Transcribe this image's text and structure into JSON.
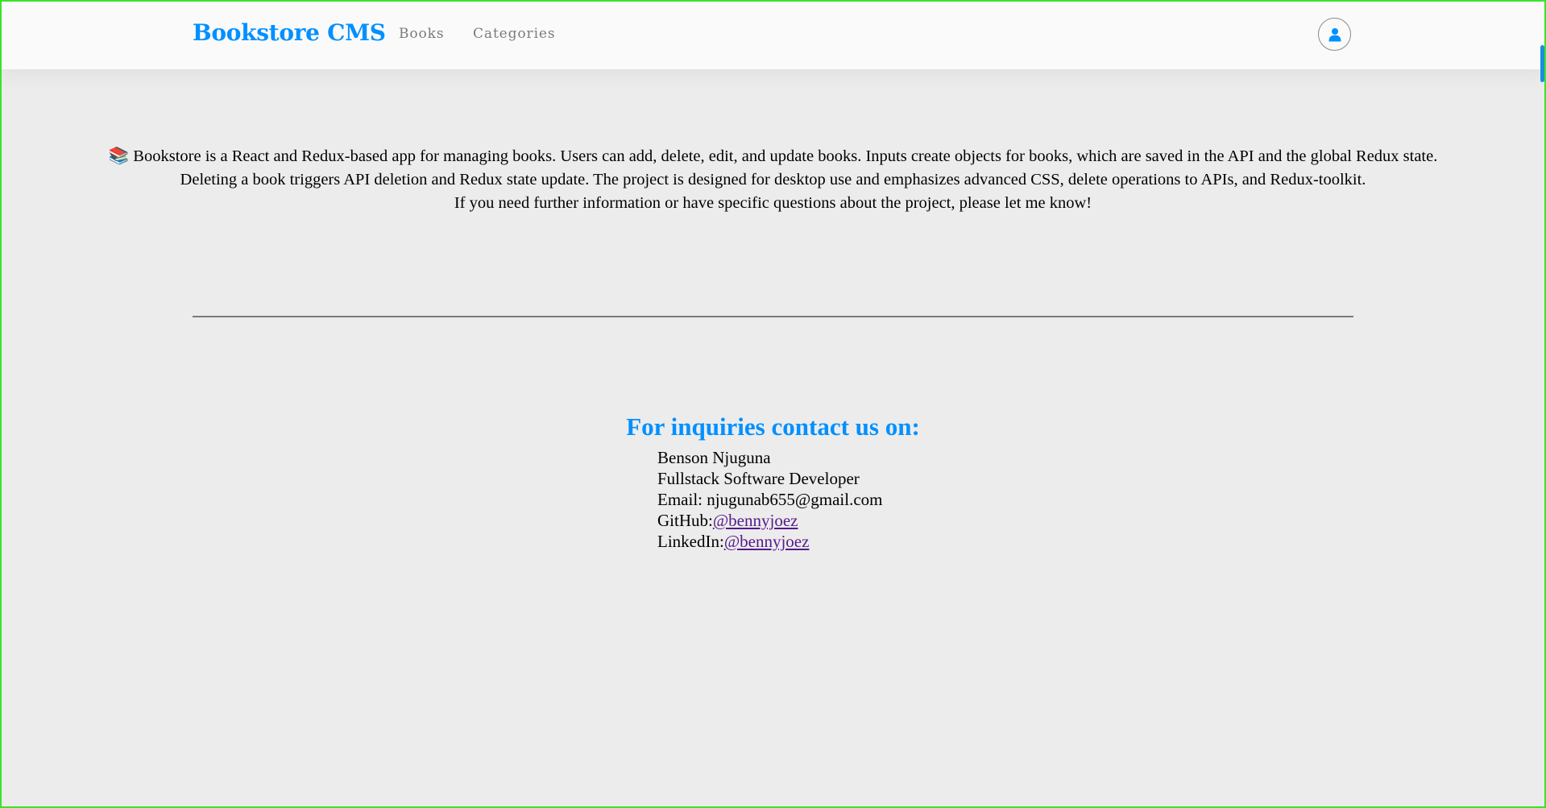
{
  "navbar": {
    "brand": "Bookstore CMS",
    "links": [
      {
        "label": "Books"
      },
      {
        "label": "Categories"
      }
    ],
    "profile_icon": "user-icon"
  },
  "about": {
    "emoji": "📚",
    "lines": [
      "Bookstore is a React and Redux-based app for managing books. Users can add, delete, edit, and update books. Inputs create objects for books, which are saved in the API and the global Redux state.",
      "Deleting a book triggers API deletion and Redux state update. The project is designed for desktop use and emphasizes advanced CSS, delete operations to APIs, and Redux-toolkit.",
      "If you need further information or have specific questions about the project, please let me know!"
    ]
  },
  "contact": {
    "heading": "For inquiries contact us on:",
    "name": "Benson Njuguna",
    "title": "Fullstack Software Developer",
    "email_label": "Email: ",
    "email": "njugunab655@gmail.com",
    "github_label": "GitHub:",
    "github_handle": "@bennyjoez",
    "linkedin_label": "LinkedIn:",
    "linkedin_handle": "@bennyjoez"
  },
  "colors": {
    "brand": "#0290ff",
    "background": "#ececec",
    "navbar": "#fafafa",
    "link_visited": "#551a8b",
    "frame_border": "#3be32b"
  }
}
